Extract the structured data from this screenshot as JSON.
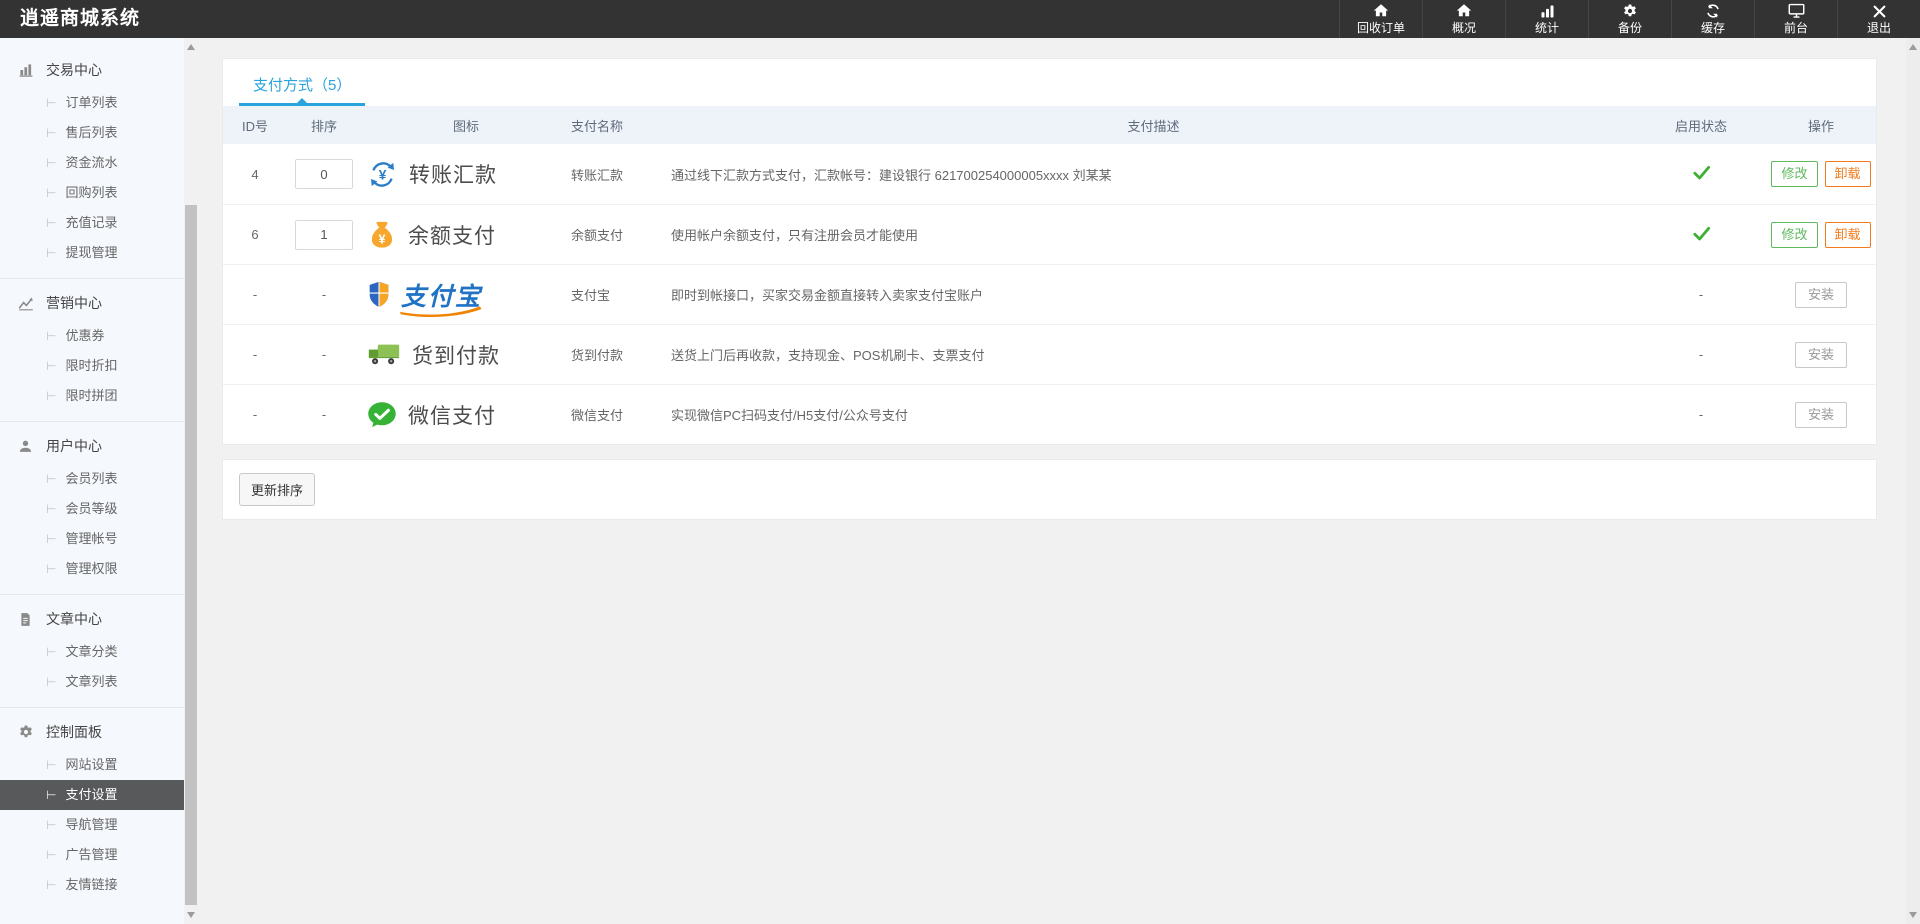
{
  "topbar": {
    "title": "逍遥商城系统",
    "items": [
      {
        "label": "回收订单",
        "name": "recycle-orders",
        "icon": "home"
      },
      {
        "label": "概况",
        "name": "overview",
        "icon": "home"
      },
      {
        "label": "统计",
        "name": "statistics",
        "icon": "stats"
      },
      {
        "label": "备份",
        "name": "backup",
        "icon": "gear"
      },
      {
        "label": "缓存",
        "name": "cache",
        "icon": "sync"
      },
      {
        "label": "前台",
        "name": "frontend",
        "icon": "monitor"
      },
      {
        "label": "退出",
        "name": "logout",
        "icon": "close"
      }
    ]
  },
  "sidebar": {
    "sections": [
      {
        "title": "交易中心",
        "name": "trade-center",
        "icon": "chart-bar",
        "items": [
          {
            "label": "订单列表",
            "name": "order-list"
          },
          {
            "label": "售后列表",
            "name": "aftersale-list"
          },
          {
            "label": "资金流水",
            "name": "capital-flow"
          },
          {
            "label": "回购列表",
            "name": "buyback-list"
          },
          {
            "label": "充值记录",
            "name": "recharge-records"
          },
          {
            "label": "提现管理",
            "name": "withdraw-manage"
          }
        ]
      },
      {
        "title": "营销中心",
        "name": "marketing-center",
        "icon": "trend",
        "items": [
          {
            "label": "优惠券",
            "name": "coupons"
          },
          {
            "label": "限时折扣",
            "name": "flash-discount"
          },
          {
            "label": "限时拼团",
            "name": "group-buy"
          }
        ]
      },
      {
        "title": "用户中心",
        "name": "user-center",
        "icon": "user",
        "items": [
          {
            "label": "会员列表",
            "name": "member-list"
          },
          {
            "label": "会员等级",
            "name": "member-levels"
          },
          {
            "label": "管理帐号",
            "name": "admin-accounts"
          },
          {
            "label": "管理权限",
            "name": "admin-permissions"
          }
        ]
      },
      {
        "title": "文章中心",
        "name": "article-center",
        "icon": "doc",
        "items": [
          {
            "label": "文章分类",
            "name": "article-categories"
          },
          {
            "label": "文章列表",
            "name": "article-list"
          }
        ]
      },
      {
        "title": "控制面板",
        "name": "control-panel",
        "icon": "gear",
        "items": [
          {
            "label": "网站设置",
            "name": "site-settings"
          },
          {
            "label": "支付设置",
            "name": "payment-settings",
            "active": true
          },
          {
            "label": "导航管理",
            "name": "nav-manage"
          },
          {
            "label": "广告管理",
            "name": "ad-manage"
          },
          {
            "label": "友情链接",
            "name": "friend-links"
          }
        ]
      }
    ]
  },
  "main": {
    "tab": {
      "label": "支付方式（5）"
    },
    "table": {
      "headers": [
        "ID号",
        "排序",
        "图标",
        "支付名称",
        "支付描述",
        "启用状态",
        "操作"
      ],
      "rows": [
        {
          "id": "4",
          "sort": "0",
          "brand": "转账汇款",
          "icon": "transfer",
          "name": "转账汇款",
          "desc": "通过线下汇款方式支付，汇款帐号：建设银行 621700254000005xxxx 刘某某",
          "enabled": true,
          "actions": [
            {
              "label": "修改",
              "type": "modify"
            },
            {
              "label": "卸载",
              "type": "uninstall"
            }
          ]
        },
        {
          "id": "6",
          "sort": "1",
          "brand": "余额支付",
          "icon": "balance",
          "name": "余额支付",
          "desc": "使用帐户余额支付，只有注册会员才能使用",
          "enabled": true,
          "actions": [
            {
              "label": "修改",
              "type": "modify"
            },
            {
              "label": "卸载",
              "type": "uninstall"
            }
          ]
        },
        {
          "id": "-",
          "sort": null,
          "brand": "支付宝",
          "icon": "alipay",
          "name": "支付宝",
          "desc": "即时到帐接口，买家交易金额直接转入卖家支付宝账户",
          "enabled": false,
          "actions": [
            {
              "label": "安装",
              "type": "install"
            }
          ]
        },
        {
          "id": "-",
          "sort": null,
          "brand": "货到付款",
          "icon": "cod",
          "name": "货到付款",
          "desc": "送货上门后再收款，支持现金、POS机刷卡、支票支付",
          "enabled": false,
          "actions": [
            {
              "label": "安装",
              "type": "install"
            }
          ]
        },
        {
          "id": "-",
          "sort": null,
          "brand": "微信支付",
          "icon": "wechat",
          "name": "微信支付",
          "desc": "实现微信PC扫码支付/H5支付/公众号支付",
          "enabled": false,
          "actions": [
            {
              "label": "安装",
              "type": "install"
            }
          ]
        }
      ],
      "empty_placeholder": "-"
    },
    "update_sort_label": "更新排序"
  },
  "colors": {
    "topbar_bg": "#333333",
    "accent_blue": "#2ba3dc",
    "success_green": "#3eb135",
    "button_green": "#5eb95e",
    "button_orange": "#f37b1d",
    "active_item_bg": "#58595b",
    "sidebar_bg": "#f5f8fc",
    "table_header_bg": "#eef3fa"
  }
}
